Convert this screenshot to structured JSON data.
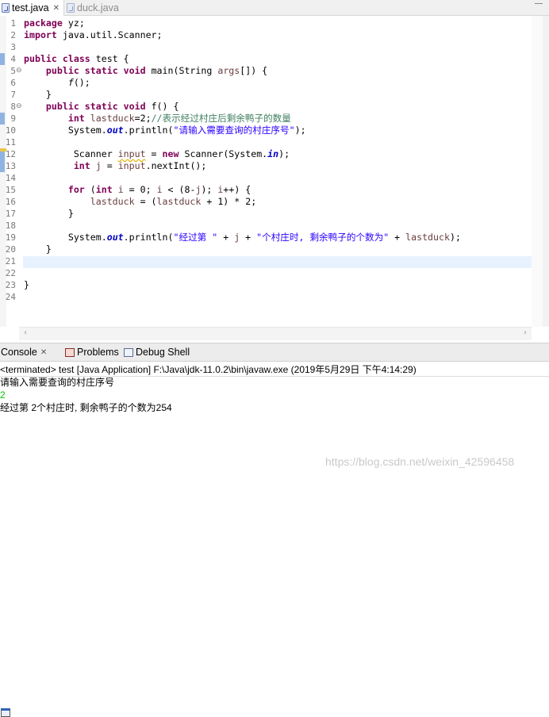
{
  "editor_tabs": [
    {
      "label": "test.java",
      "close": "✕"
    },
    {
      "label": "duck.java"
    }
  ],
  "line_numbers": [
    "1",
    "2",
    "3",
    "4",
    "5",
    "6",
    "7",
    "8",
    "9",
    "10",
    "11",
    "12",
    "13",
    "14",
    "15",
    "16",
    "17",
    "18",
    "19",
    "20",
    "21",
    "22",
    "23",
    "24"
  ],
  "fold_markers": {
    "line5": "⊖",
    "line8": "⊖"
  },
  "code": {
    "l1_kw": "package",
    "l1_rest": " yz;",
    "l2_kw": "import",
    "l2_rest": " java.util.Scanner;",
    "l4_kw1": "public",
    "l4_kw2": "class",
    "l4_rest": " test {",
    "l5_kw1": "public",
    "l5_kw2": "static",
    "l5_kw3": "void",
    "l5_a": " main(String ",
    "l5_var": "args",
    "l5_b": "[]) {",
    "l6_fn": "f",
    "l6_rest": "();",
    "l7": "}",
    "l8_kw1": "public",
    "l8_kw2": "static",
    "l8_kw3": "void",
    "l8_rest": " f() {",
    "l9_kw": "int",
    "l9_var": "lastduck",
    "l9_rest": "=2;",
    "l9_comment": "//表示经过村庄后剩余鸭子的数量",
    "l10_a": "System.",
    "l10_fld": "out",
    "l10_b": ".println(",
    "l10_str": "\"请输入需要查询的村庄序号\"",
    "l10_c": ");",
    "l12_a": "Scanner ",
    "l12_var": "input",
    "l12_b": " = ",
    "l12_kw": "new",
    "l12_c": " Scanner(System.",
    "l12_fld": "in",
    "l12_d": ");",
    "l13_kw": "int",
    "l13_var": "j",
    "l13_b": " = ",
    "l13_var2": "input",
    "l13_c": ".nextInt();",
    "l15_kw1": "for",
    "l15_a": " (",
    "l15_kw2": "int",
    "l15_var": "i",
    "l15_b": " = 0; ",
    "l15_var2": "i",
    "l15_c": " < (8-",
    "l15_var3": "j",
    "l15_d": "); ",
    "l15_var4": "i",
    "l15_e": "++) {",
    "l16_var": "lastduck",
    "l16_a": " = (",
    "l16_var2": "lastduck",
    "l16_b": " + 1) * 2;",
    "l17": "}",
    "l19_a": "System.",
    "l19_fld": "out",
    "l19_b": ".println(",
    "l19_str1": "\"经过第 \"",
    "l19_c": " + ",
    "l19_var": "j",
    "l19_d": " + ",
    "l19_str2": "\"个村庄时, 剩余鸭子的个数为\"",
    "l19_e": " + ",
    "l19_var2": "lastduck",
    "l19_f": ");",
    "l20": "}",
    "l23": "}"
  },
  "console_tabs": [
    {
      "label": "Console",
      "close": "✕"
    },
    {
      "label": "Problems"
    },
    {
      "label": "Debug Shell"
    }
  ],
  "console": {
    "header": "<terminated> test [Java Application] F:\\Java\\jdk-11.0.2\\bin\\javaw.exe (2019年5月29日 下午4:14:29)",
    "prompt": "请输入需要查询的村庄序号",
    "user_input": "2",
    "result": "经过第 2个村庄时, 剩余鸭子的个数为254"
  },
  "watermark": "https://blog.csdn.net/weixin_42596458",
  "scroll_arrows": {
    "left": "‹",
    "right": "›"
  },
  "colors": {
    "keyword": "#7f0055",
    "comment": "#3f7f5f",
    "string": "#2a00ff",
    "field": "#0000c0",
    "variable": "#6a3e3e",
    "user_input": "#00c000",
    "current_line": "#e8f2fe"
  }
}
